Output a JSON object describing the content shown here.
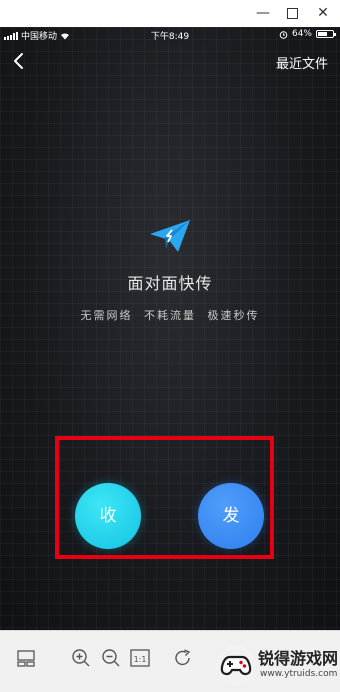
{
  "window": {
    "minimize_icon": "minimize-icon",
    "maximize_icon": "maximize-icon",
    "close_icon": "close-icon"
  },
  "status_bar": {
    "carrier": "中国移动",
    "time": "下午8:49",
    "battery": "64%",
    "battery_level": 0.64
  },
  "nav": {
    "back_icon": "chevron-left-icon",
    "recent_files": "最近文件"
  },
  "hero": {
    "icon": "paper-plane-icon",
    "title": "面对面快传",
    "subtitle": "无需网络 不耗流量 极速秒传"
  },
  "actions": {
    "receive": "收",
    "send": "发"
  },
  "colors": {
    "highlight": "#e60012",
    "receive": "#1ec8e6",
    "send": "#3388f0",
    "plane": "#29a8f0"
  },
  "toolbar": {
    "icons": [
      "thumbnail-icon",
      "zoom-in-icon",
      "zoom-out-icon",
      "actual-size-icon",
      "rotate-icon"
    ],
    "actual_size_label": "1:1"
  },
  "watermark": {
    "name": "锐得游戏网",
    "url": "www.ytruids.com"
  }
}
